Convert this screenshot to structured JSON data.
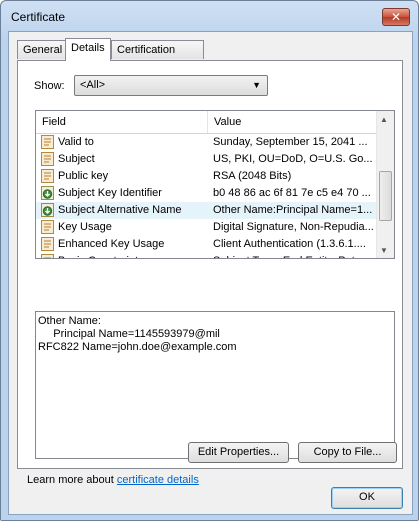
{
  "window": {
    "title": "Certificate",
    "close_glyph": "✕"
  },
  "tabs": [
    {
      "label": "General"
    },
    {
      "label": "Details"
    },
    {
      "label": "Certification Path"
    }
  ],
  "show": {
    "label": "Show:",
    "selected": "<All>"
  },
  "list": {
    "columns": {
      "field": "Field",
      "value": "Value"
    },
    "rows": [
      {
        "icon": "certificate-field-icon",
        "field": "Valid to",
        "value": "Sunday, September 15, 2041 ..."
      },
      {
        "icon": "certificate-field-icon",
        "field": "Subject",
        "value": "US, PKI, OU=DoD, O=U.S. Go..."
      },
      {
        "icon": "certificate-field-icon",
        "field": "Public key",
        "value": "RSA (2048 Bits)"
      },
      {
        "icon": "extension-download-icon",
        "field": "Subject Key Identifier",
        "value": "b0 48 86 ac 6f 81 7e c5 e4 70 ..."
      },
      {
        "icon": "extension-download-icon",
        "field": "Subject Alternative Name",
        "value": "Other Name:Principal Name=1...",
        "selected": true
      },
      {
        "icon": "certificate-field-icon",
        "field": "Key Usage",
        "value": "Digital Signature, Non-Repudia..."
      },
      {
        "icon": "certificate-field-icon",
        "field": "Enhanced Key Usage",
        "value": "Client Authentication (1.3.6.1...."
      },
      {
        "icon": "certificate-field-icon",
        "field": "Basic Constraints",
        "value": "Subject Type=End Entity, Pat..."
      }
    ]
  },
  "detail": {
    "lines": [
      "Other Name:",
      "     Principal Name=1145593979@mil",
      "RFC822 Name=john.doe@example.com"
    ]
  },
  "buttons": {
    "edit_properties": "Edit Properties...",
    "copy_to_file": "Copy to File...",
    "ok": "OK"
  },
  "learn_more": {
    "prefix": "Learn more about ",
    "link": "certificate details"
  }
}
